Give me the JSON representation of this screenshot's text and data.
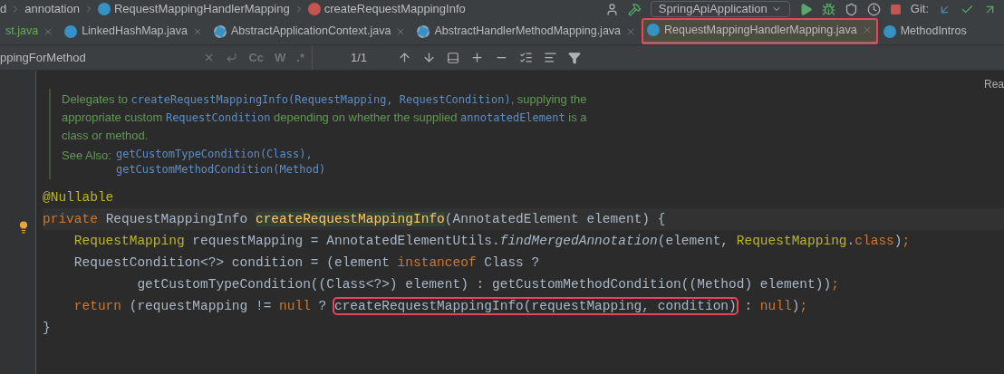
{
  "breadcrumbs": [
    {
      "label": "d",
      "kind": "folder"
    },
    {
      "label": "annotation",
      "kind": "folder"
    },
    {
      "label": "RequestMappingHandlerMapping",
      "kind": "class"
    },
    {
      "label": "createRequestMappingInfo",
      "kind": "method"
    }
  ],
  "run_config": {
    "label": "SpringApiApplication"
  },
  "git_label": "Git:",
  "tabs": [
    {
      "label": "st.java",
      "selected": false,
      "modified": true,
      "highlighted": false,
      "kind": "plain"
    },
    {
      "label": "LinkedHashMap.java",
      "selected": false,
      "modified": false,
      "highlighted": false,
      "kind": "class"
    },
    {
      "label": "AbstractApplicationContext.java",
      "selected": false,
      "modified": false,
      "highlighted": false,
      "kind": "abstract"
    },
    {
      "label": "AbstractHandlerMethodMapping.java",
      "selected": false,
      "modified": false,
      "highlighted": false,
      "kind": "abstract"
    },
    {
      "label": "RequestMappingHandlerMapping.java",
      "selected": true,
      "modified": false,
      "highlighted": true,
      "kind": "class"
    },
    {
      "label": "MethodIntros",
      "selected": false,
      "modified": false,
      "highlighted": false,
      "kind": "class"
    }
  ],
  "search": {
    "value": "ppingForMethod",
    "options": [
      "Cc",
      "W",
      ".*"
    ],
    "count": "1/1"
  },
  "reader_mode": "Rea",
  "doc": {
    "parts": [
      {
        "kind": "text",
        "text": "Delegates to "
      },
      {
        "kind": "code",
        "text": "createRequestMappingInfo(RequestMapping, RequestCondition)"
      },
      {
        "kind": "text",
        "text": ", supplying the appropriate custom "
      },
      {
        "kind": "code",
        "text": "RequestCondition"
      },
      {
        "kind": "text",
        "text": " depending on whether the supplied "
      },
      {
        "kind": "code",
        "text": "annotatedElement"
      },
      {
        "kind": "text",
        "text": " is a class or method."
      }
    ],
    "see_also_label": "See Also:",
    "see_also": [
      "getCustomTypeCondition(Class),",
      "getCustomMethodCondition(Method)"
    ]
  },
  "code_lines": [
    {
      "bulb": false,
      "tokens": [
        {
          "kind": "annotation",
          "text": "@Nullable"
        }
      ]
    },
    {
      "bulb": true,
      "tokens": [
        {
          "kind": "keyword",
          "text": "private "
        },
        {
          "kind": "plain",
          "text": "RequestMappingInfo "
        },
        {
          "kind": "declaration",
          "text": "createRequestMappingInfo"
        },
        {
          "kind": "plain",
          "text": "(AnnotatedElement element) {"
        }
      ]
    },
    {
      "bulb": false,
      "tokens": [
        {
          "kind": "annotation",
          "text": "    RequestMapping"
        },
        {
          "kind": "plain",
          "text": " requestMapping = AnnotatedElementUtils."
        },
        {
          "kind": "italic",
          "text": "findMergedAnnotation"
        },
        {
          "kind": "plain",
          "text": "(element, "
        },
        {
          "kind": "annotation",
          "text": "RequestMapping"
        },
        {
          "kind": "plain",
          "text": "."
        },
        {
          "kind": "keyword",
          "text": "class"
        },
        {
          "kind": "plain",
          "text": ")"
        },
        {
          "kind": "keyword",
          "text": ";"
        }
      ]
    },
    {
      "bulb": false,
      "tokens": [
        {
          "kind": "plain",
          "text": "    RequestCondition<?> condition = (element "
        },
        {
          "kind": "keyword",
          "text": "instanceof"
        },
        {
          "kind": "plain",
          "text": " Class ?"
        }
      ]
    },
    {
      "bulb": false,
      "tokens": [
        {
          "kind": "plain",
          "text": "            getCustomTypeCondition((Class<?>) element) : getCustomMethodCondition((Method) element))"
        },
        {
          "kind": "keyword",
          "text": ";"
        }
      ]
    },
    {
      "bulb": false,
      "tokens": [
        {
          "kind": "keyword",
          "text": "    return"
        },
        {
          "kind": "plain",
          "text": " (requestMapping != "
        },
        {
          "kind": "keyword",
          "text": "null"
        },
        {
          "kind": "plain",
          "text": " ? "
        },
        {
          "kind": "plain",
          "text": "createRequestMappingInfo(requestMapping, condition)",
          "boxed": true
        },
        {
          "kind": "plain",
          "text": " : "
        },
        {
          "kind": "keyword",
          "text": "null"
        },
        {
          "kind": "plain",
          "text": ")"
        },
        {
          "kind": "keyword",
          "text": ";"
        }
      ]
    },
    {
      "bulb": false,
      "tokens": [
        {
          "kind": "plain",
          "text": "}"
        }
      ]
    }
  ]
}
